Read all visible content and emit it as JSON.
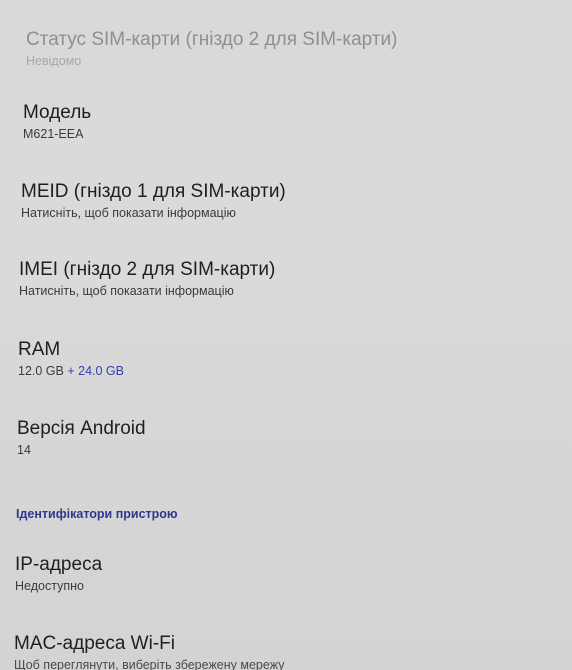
{
  "settings_list": {
    "sim_status": {
      "title": "Статус SIM-карти (гніздо 2 для SIM-карти)",
      "summary": "Невідомо"
    },
    "model": {
      "title": "Модель",
      "summary": "M621-EEA"
    },
    "meid": {
      "title": "MEID (гніздо 1 для SIM-карти)",
      "summary": "Натисніть, щоб показати інформацію"
    },
    "imei": {
      "title": "IMEI (гніздо 2 для SIM-карти)",
      "summary": "Натисніть, щоб показати інформацію"
    },
    "ram": {
      "title": "RAM",
      "summary_base": "12.0 GB",
      "summary_extra": " + 24.0 GB"
    },
    "android_version": {
      "title": "Версія Android",
      "summary": "14"
    },
    "section_device_identifiers": "Ідентифікатори пристрою",
    "ip_address": {
      "title": "IP-адреса",
      "summary": "Недоступно"
    },
    "mac_address": {
      "title": "MAC-адреса Wi-Fi",
      "summary": "Щоб переглянути, виберіть збережену мережу"
    }
  },
  "colors": {
    "background": "#d9d9d9",
    "title_text": "#1f1f1f",
    "summary_text": "#3b3b3b",
    "faded_text": "#8f8f8f",
    "accent": "#3142a8",
    "section_header": "#31368f"
  }
}
